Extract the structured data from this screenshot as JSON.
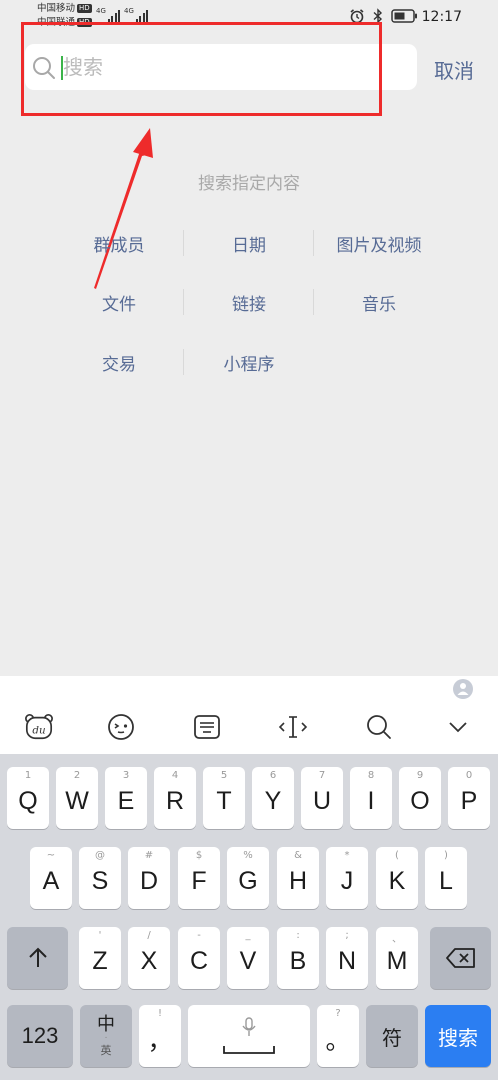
{
  "status_bar": {
    "carrier_1": "中国移动",
    "carrier_2": "中国联通",
    "hd": "HD",
    "network_1": "4G",
    "network_2": "4G",
    "time": "12:17"
  },
  "search": {
    "placeholder": "搜索",
    "value": "",
    "cancel_label": "取消"
  },
  "filters": {
    "title": "搜索指定内容",
    "items": [
      "群成员",
      "日期",
      "图片及视频",
      "文件",
      "链接",
      "音乐",
      "交易",
      "小程序"
    ]
  },
  "keyboard": {
    "toolbar_icons": [
      "du-bear-icon",
      "emoji-icon",
      "keyboard-layout-icon",
      "cursor-icon",
      "search-icon",
      "collapse-chevron-icon"
    ],
    "row1": [
      {
        "key": "Q",
        "sub": "1"
      },
      {
        "key": "W",
        "sub": "2"
      },
      {
        "key": "E",
        "sub": "3"
      },
      {
        "key": "R",
        "sub": "4"
      },
      {
        "key": "T",
        "sub": "5"
      },
      {
        "key": "Y",
        "sub": "6"
      },
      {
        "key": "U",
        "sub": "7"
      },
      {
        "key": "I",
        "sub": "8"
      },
      {
        "key": "O",
        "sub": "9"
      },
      {
        "key": "P",
        "sub": "0"
      }
    ],
    "row2": [
      {
        "key": "A",
        "sub": "~"
      },
      {
        "key": "S",
        "sub": "@"
      },
      {
        "key": "D",
        "sub": "#"
      },
      {
        "key": "F",
        "sub": "$"
      },
      {
        "key": "G",
        "sub": "%"
      },
      {
        "key": "H",
        "sub": "&"
      },
      {
        "key": "J",
        "sub": "*"
      },
      {
        "key": "K",
        "sub": "("
      },
      {
        "key": "L",
        "sub": ")"
      }
    ],
    "row3": [
      {
        "key": "Z",
        "sub": "'"
      },
      {
        "key": "X",
        "sub": "/"
      },
      {
        "key": "C",
        "sub": "-"
      },
      {
        "key": "V",
        "sub": "_"
      },
      {
        "key": "B",
        "sub": ":"
      },
      {
        "key": "N",
        "sub": ";"
      },
      {
        "key": "M",
        "sub": "、"
      }
    ],
    "numbers_label": "123",
    "lang_zh": "中",
    "lang_dot": "·",
    "lang_en": "英",
    "comma_label": "，",
    "comma_sub": "!",
    "period_label": "。",
    "period_sub": "?",
    "symbols_label": "符",
    "search_label": "搜索"
  }
}
